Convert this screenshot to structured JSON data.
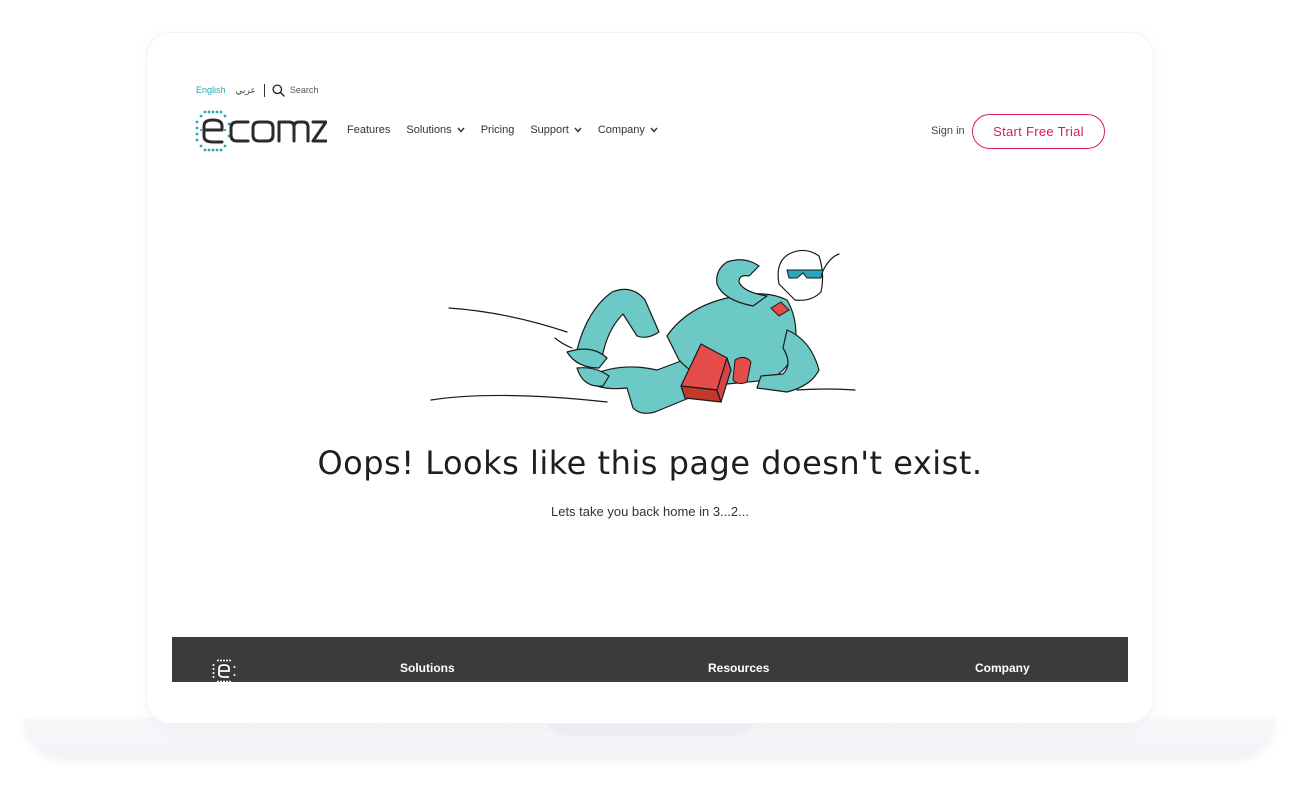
{
  "topbar": {
    "lang_english": "English",
    "lang_arabic": "عربي",
    "search_label": "Search"
  },
  "brand": {
    "name": "ecomz"
  },
  "nav": {
    "items": [
      {
        "label": "Features",
        "has_dropdown": false
      },
      {
        "label": "Solutions",
        "has_dropdown": true
      },
      {
        "label": "Pricing",
        "has_dropdown": false
      },
      {
        "label": "Support",
        "has_dropdown": true
      },
      {
        "label": "Company",
        "has_dropdown": true
      }
    ],
    "signin_label": "Sign in",
    "trial_label": "Start Free Trial"
  },
  "error": {
    "headline": "Oops! Looks like this page doesn't exist.",
    "subline": "Lets take you back home in 3...2..."
  },
  "footer": {
    "col_solutions": "Solutions",
    "col_resources": "Resources",
    "col_company": "Company"
  },
  "colors": {
    "accent": "#2aa6b8",
    "cta": "#d81b60",
    "footer_bg": "#3b3b3b",
    "figure": "#6cc9c5"
  }
}
